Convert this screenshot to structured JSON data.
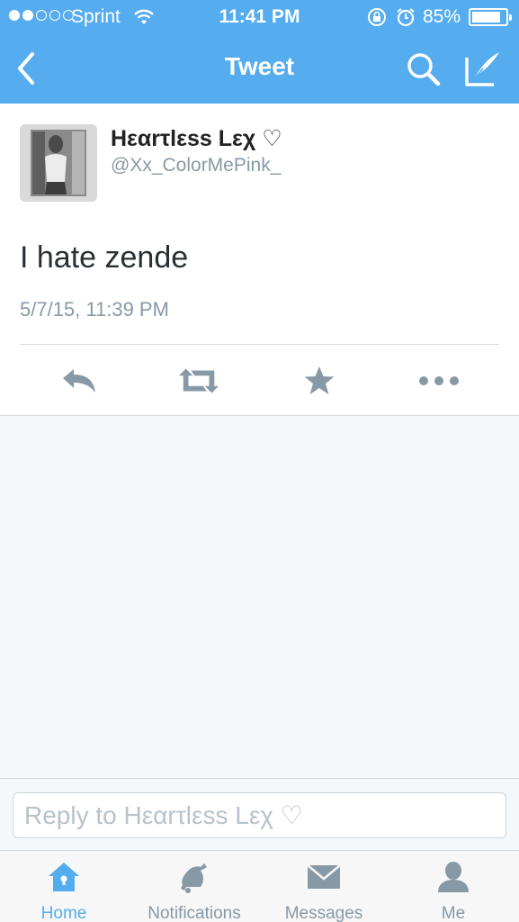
{
  "status_bar": {
    "carrier": "Sprint",
    "time": "11:41 PM",
    "battery": "85%",
    "battery_level": 0.85,
    "signal_bars_filled": 2,
    "signal_bars_total": 5
  },
  "nav": {
    "title": "Tweet"
  },
  "tweet": {
    "display_name": "Hεαrτlεss Lεχ ♡",
    "handle": "@Xx_ColorMePink_",
    "text": "I hate zende",
    "timestamp": "5/7/15, 11:39 PM"
  },
  "reply": {
    "placeholder": "Reply to Hεαrτlεss Lεχ ♡"
  },
  "tabs": [
    {
      "label": "Home",
      "icon": "home-icon",
      "active": true
    },
    {
      "label": "Notifications",
      "icon": "bell-icon",
      "active": false
    },
    {
      "label": "Messages",
      "icon": "envelope-icon",
      "active": false
    },
    {
      "label": "Me",
      "icon": "person-icon",
      "active": false
    }
  ],
  "colors": {
    "brand": "#55acee",
    "secondary_text": "#8899a6",
    "icon_gray": "#8899a6"
  }
}
